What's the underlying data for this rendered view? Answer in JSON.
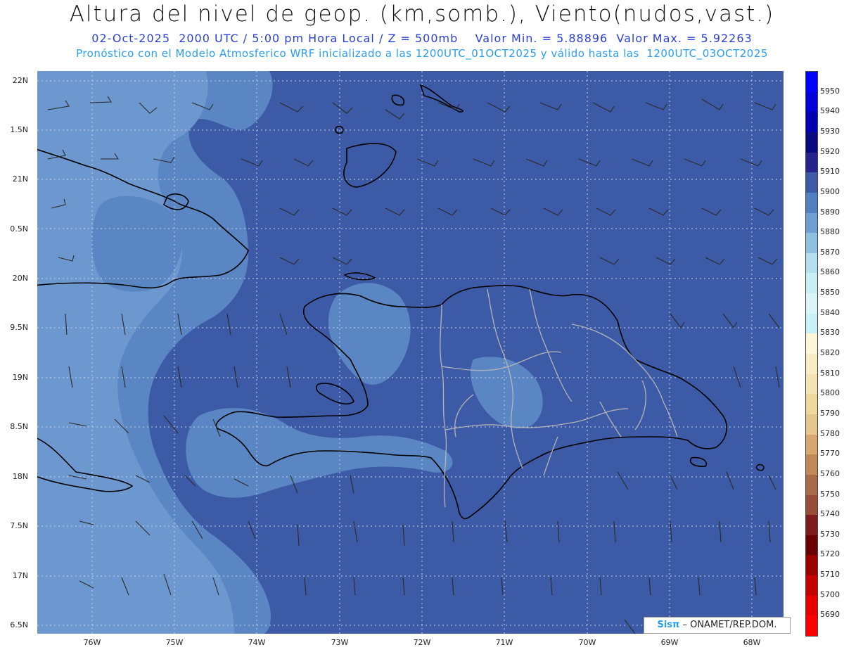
{
  "header": {
    "title": "Altura del nivel de geop. (km,somb.), Viento(nudos,vast.)",
    "line1": "02-Oct-2025  2000 UTC / 5:00 pm Hora Local / Z = 500mb    Valor Min. = 5.88896  Valor Max. = 5.92263",
    "line2": "Pronóstico con el Modelo Atmosferico WRF inicializado a las 1200UTC_01OCT2025 y válido hasta las  1200UTC_03OCT2025"
  },
  "axes": {
    "lat_labels": [
      "22N",
      "1.5N",
      "21N",
      "0.5N",
      "20N",
      "9.5N",
      "19N",
      "8.5N",
      "18N",
      "7.5N",
      "17N",
      "6.5N"
    ],
    "lon_labels": [
      "76W",
      "75W",
      "74W",
      "73W",
      "72W",
      "71W",
      "70W",
      "69W",
      "68W"
    ]
  },
  "colorbar": {
    "labels": [
      "5950",
      "5940",
      "5930",
      "5920",
      "5910",
      "5900",
      "5890",
      "5880",
      "5870",
      "5860",
      "5850",
      "5840",
      "5830",
      "5820",
      "5810",
      "5800",
      "5790",
      "5780",
      "5770",
      "5760",
      "5750",
      "5740",
      "5730",
      "5720",
      "5710",
      "5700",
      "5690"
    ],
    "colors": [
      "#0000ff",
      "#0000d8",
      "#0000b0",
      "#0a0a80",
      "#24248c",
      "#3d5aa6",
      "#5080c0",
      "#6f9ed0",
      "#90bfe0",
      "#b4e0ee",
      "#c8eef4",
      "#daf4fa",
      "#c8f2f8",
      "#fdf6d8",
      "#f8ecc4",
      "#f4e2b4",
      "#eed8a0",
      "#e6c690",
      "#d6a870",
      "#c08a58",
      "#a86a48",
      "#984c38",
      "#7c1c1c",
      "#6a0000",
      "#9a0000",
      "#c40000",
      "#e80000",
      "#ff0000"
    ],
    "shade_light": "#5b86c4",
    "shade_lighter": "#6d97cf",
    "shade_base": "#3d5aa6"
  },
  "credit": {
    "sis": "Sisπ",
    "org": "– ONAMET/REP.DOM."
  }
}
